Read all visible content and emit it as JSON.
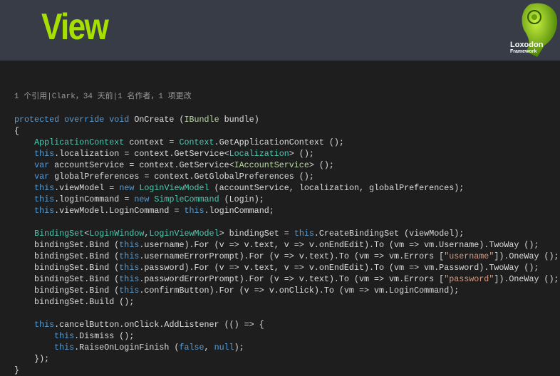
{
  "header": {
    "title": "View",
    "logo_title": "Loxodon",
    "logo_subtitle": "Framework"
  },
  "colors": {
    "title": "#a6e000",
    "keyword": "#569cd6",
    "type": "#4ec9b0",
    "interface": "#b8d7a3",
    "string": "#d69d85"
  },
  "codelens": "1 个引用|Clark，34 天前|1 名作者，1 项更改",
  "lines": [
    [
      [
        "protected override void",
        "kw"
      ],
      [
        " OnCreate (",
        ""
      ],
      [
        "IBundle",
        "if"
      ],
      [
        " bundle)",
        ""
      ]
    ],
    [
      [
        "{",
        ""
      ]
    ],
    [
      [
        "    ",
        ""
      ],
      [
        "ApplicationContext",
        "ty"
      ],
      [
        " context = ",
        ""
      ],
      [
        "Context",
        "ty"
      ],
      [
        ".GetApplicationContext ();",
        ""
      ]
    ],
    [
      [
        "    ",
        ""
      ],
      [
        "this",
        "kw"
      ],
      [
        ".localization = context.GetService<",
        ""
      ],
      [
        "Localization",
        "ty"
      ],
      [
        "> ();",
        ""
      ]
    ],
    [
      [
        "    ",
        ""
      ],
      [
        "var",
        "kw"
      ],
      [
        " accountService = context.GetService<",
        ""
      ],
      [
        "IAccountService",
        "if"
      ],
      [
        "> ();",
        ""
      ]
    ],
    [
      [
        "    ",
        ""
      ],
      [
        "var",
        "kw"
      ],
      [
        " globalPreferences = context.GetGlobalPreferences ();",
        ""
      ]
    ],
    [
      [
        "    ",
        ""
      ],
      [
        "this",
        "kw"
      ],
      [
        ".viewModel = ",
        ""
      ],
      [
        "new",
        "kw"
      ],
      [
        " ",
        ""
      ],
      [
        "LoginViewModel",
        "ty"
      ],
      [
        " (accountService, localization, globalPreferences);",
        ""
      ]
    ],
    [
      [
        "    ",
        ""
      ],
      [
        "this",
        "kw"
      ],
      [
        ".loginCommand = ",
        ""
      ],
      [
        "new",
        "kw"
      ],
      [
        " ",
        ""
      ],
      [
        "SimpleCommand",
        "ty"
      ],
      [
        " (Login);",
        ""
      ]
    ],
    [
      [
        "    ",
        ""
      ],
      [
        "this",
        "kw"
      ],
      [
        ".viewModel.LoginCommand = ",
        ""
      ],
      [
        "this",
        "kw"
      ],
      [
        ".loginCommand;",
        ""
      ]
    ],
    [],
    [
      [
        "    ",
        ""
      ],
      [
        "BindingSet",
        "ty"
      ],
      [
        "<",
        ""
      ],
      [
        "LoginWindow",
        "ty"
      ],
      [
        ",",
        ""
      ],
      [
        "LoginViewModel",
        "ty"
      ],
      [
        "> bindingSet = ",
        ""
      ],
      [
        "this",
        "kw"
      ],
      [
        ".CreateBindingSet (viewModel);",
        ""
      ]
    ],
    [
      [
        "    bindingSet.Bind (",
        ""
      ],
      [
        "this",
        "kw"
      ],
      [
        ".username).For (v => v.text, v => v.onEndEdit).To (vm => vm.Username).TwoWay ();",
        ""
      ]
    ],
    [
      [
        "    bindingSet.Bind (",
        ""
      ],
      [
        "this",
        "kw"
      ],
      [
        ".usernameErrorPrompt).For (v => v.text).To (vm => vm.Errors [",
        ""
      ],
      [
        "\"username\"",
        "st"
      ],
      [
        "]).OneWay ();",
        ""
      ]
    ],
    [
      [
        "    bindingSet.Bind (",
        ""
      ],
      [
        "this",
        "kw"
      ],
      [
        ".password).For (v => v.text, v => v.onEndEdit).To (vm => vm.Password).TwoWay ();",
        ""
      ]
    ],
    [
      [
        "    bindingSet.Bind (",
        ""
      ],
      [
        "this",
        "kw"
      ],
      [
        ".passwordErrorPrompt).For (v => v.text).To (vm => vm.Errors [",
        ""
      ],
      [
        "\"password\"",
        "st"
      ],
      [
        "]).OneWay ();",
        ""
      ]
    ],
    [
      [
        "    bindingSet.Bind (",
        ""
      ],
      [
        "this",
        "kw"
      ],
      [
        ".confirmButton).For (v => v.onClick).To (vm => vm.LoginCommand);",
        ""
      ]
    ],
    [
      [
        "    bindingSet.Build ();",
        ""
      ]
    ],
    [],
    [
      [
        "    ",
        ""
      ],
      [
        "this",
        "kw"
      ],
      [
        ".cancelButton.onClick.AddListener (() => {",
        ""
      ]
    ],
    [
      [
        "        ",
        ""
      ],
      [
        "this",
        "kw"
      ],
      [
        ".Dismiss ();",
        ""
      ]
    ],
    [
      [
        "        ",
        ""
      ],
      [
        "this",
        "kw"
      ],
      [
        ".RaiseOnLoginFinish (",
        ""
      ],
      [
        "false",
        "kw"
      ],
      [
        ", ",
        ""
      ],
      [
        "null",
        "kw"
      ],
      [
        ");",
        ""
      ]
    ],
    [
      [
        "    });",
        ""
      ]
    ],
    [
      [
        "}",
        ""
      ]
    ]
  ]
}
